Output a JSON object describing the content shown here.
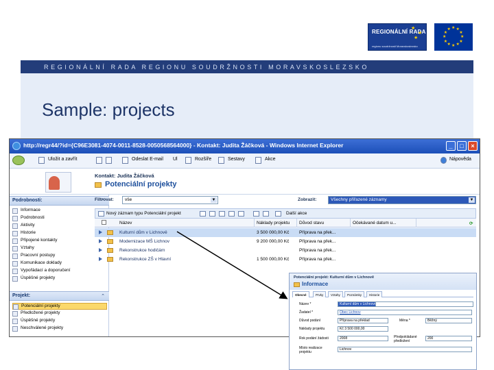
{
  "header": {
    "logo_title": "REGIONÁLNÍ RADA",
    "logo_subtitle": "regionu soudržnosti Moravskoslezsko",
    "banner_text": "REGIONÁLNÍ RADA REGIONU SOUDRŽNOSTI MORAVSKOSLEZSKO",
    "slide_title": "Sample: projects"
  },
  "window": {
    "title": "http://regr44/?id={C96E3081-4074-0011-8528-0050568564000} - Kontakt: Judita Žáčková - Windows Internet Explorer",
    "btn_min": "_",
    "btn_max": "□",
    "btn_close": "×"
  },
  "toolbar": {
    "save_close": "Uložit a zavřít",
    "send_email": "Odeslat E-mail",
    "ul": "Ul",
    "reports": "Rozšíře",
    "sestavy": "Sestavy",
    "akce": "Akce",
    "help": "Nápověda"
  },
  "crm": {
    "contact": "Kontakt: Judita Žáčková",
    "heading": "Potenciální projekty"
  },
  "nav": {
    "section1": "Podrobnosti:",
    "section1_items": [
      "Informace",
      "Podrobnosti",
      "Aktivity",
      "Historie",
      "Připojené kontakty",
      "Vztahy",
      "Pracovní postupy",
      "Komunikace doklady",
      "Vypořádací a doporučení",
      "Úspěšné projekty"
    ],
    "section2": "Projekt:",
    "section2_items": [
      "Potenciální projekty",
      "Předložené projekty",
      "Úspěšné projekty",
      "Neschválené projekty"
    ],
    "chevron": "⌃"
  },
  "filter": {
    "filter_label": "Filtrovat:",
    "filter_value": "vše",
    "show_label": "Zobrazit:",
    "show_value": "Všechny přiřazené záznamy"
  },
  "grid_toolbar": {
    "new_record": "Nový záznam typu Potenciální projekt",
    "more_actions": "Další akce"
  },
  "grid": {
    "columns": [
      "Název",
      "Náklady projektu",
      "Důvod stavu",
      "Očekávané datum u..."
    ],
    "rows": [
      {
        "name": "Kulturní dům v Lichnově",
        "cost": "3 500 000,00 Kč",
        "reason": "Příprava na přek..."
      },
      {
        "name": "Modernizace MŠ Lichnov",
        "cost": "9 200 000,00 Kč",
        "reason": "Příprava na přek..."
      },
      {
        "name": "Rekonstrukce hodičárn",
        "cost": "",
        "reason": "Příprava na přek..."
      },
      {
        "name": "Rekonstrukce ZŠ v Hlavní",
        "cost": "1 500 000,00 Kč",
        "reason": "Příprava na přek..."
      }
    ]
  },
  "form": {
    "subtitle": "Potenciální projekt: Kulturní dům v Lichnově",
    "title": "Informace",
    "tabs": [
      "Obecné",
      "Prvky",
      "Vztahy",
      "Poznámky",
      "Historie"
    ],
    "fields": {
      "name_label": "Název *",
      "name_value": "Kulturní dům v Lichnově",
      "applicant_label": "Žadatel *",
      "applicant_value": "Obec Lichnov",
      "reason_label": "Důvod podání",
      "reason_value": "Příprava na překlad",
      "currency_label": "Měna *",
      "currency_value": "Běžný",
      "cost_label": "Náklady projektu",
      "cost_value": "Kč 3 500 000,00",
      "year_label": "Rok podání žádosti",
      "year_value": "2008",
      "expected_label": "Předpokládané předložení",
      "expected_value": "200",
      "place_label": "Místo realizace projektu",
      "place_value": "Lichnov"
    }
  },
  "colors": {
    "banner": "#233d7a",
    "accent": "#1d3467",
    "selection": "#c9dcf5"
  }
}
